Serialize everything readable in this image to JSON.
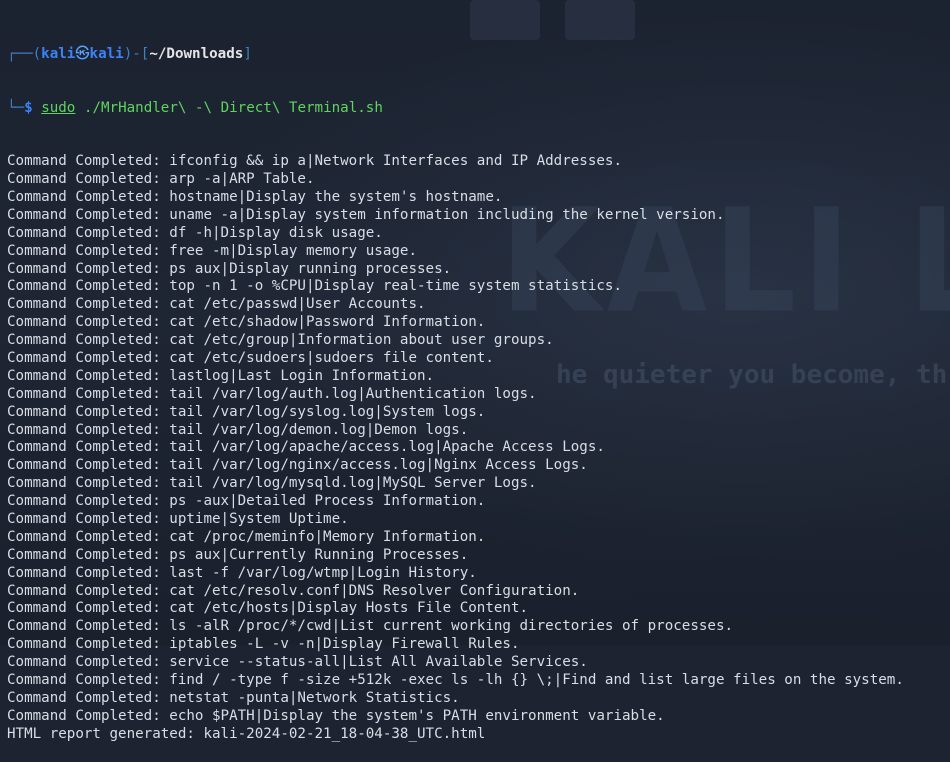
{
  "prompt": {
    "frame_top": "┌──(",
    "user": "kali",
    "at_symbol": "㉿",
    "host": "kali",
    "frame_mid": ")-[",
    "cwd": "~/Downloads",
    "frame_end": "]",
    "frame_bottom": "└─",
    "dollar": "$ ",
    "sudo": "sudo",
    "command": " ./MrHandler\\ -\\ Direct\\ Terminal.sh"
  },
  "output_lines": [
    "Command Completed: ifconfig && ip a|Network Interfaces and IP Addresses.",
    "Command Completed: arp -a|ARP Table.",
    "Command Completed: hostname|Display the system's hostname.",
    "Command Completed: uname -a|Display system information including the kernel version.",
    "Command Completed: df -h|Display disk usage.",
    "Command Completed: free -m|Display memory usage.",
    "Command Completed: ps aux|Display running processes.",
    "Command Completed: top -n 1 -o %CPU|Display real-time system statistics.",
    "Command Completed: cat /etc/passwd|User Accounts.",
    "Command Completed: cat /etc/shadow|Password Information.",
    "Command Completed: cat /etc/group|Information about user groups.",
    "Command Completed: cat /etc/sudoers|sudoers file content.",
    "Command Completed: lastlog|Last Login Information.",
    "Command Completed: tail /var/log/auth.log|Authentication logs.",
    "Command Completed: tail /var/log/syslog.log|System logs.",
    "Command Completed: tail /var/log/demon.log|Demon logs.",
    "Command Completed: tail /var/log/apache/access.log|Apache Access Logs.",
    "Command Completed: tail /var/log/nginx/access.log|Nginx Access Logs.",
    "Command Completed: tail /var/log/mysqld.log|MySQL Server Logs.",
    "Command Completed: ps -aux|Detailed Process Information.",
    "Command Completed: uptime|System Uptime.",
    "Command Completed: cat /proc/meminfo|Memory Information.",
    "Command Completed: ps aux|Currently Running Processes.",
    "Command Completed: last -f /var/log/wtmp|Login History.",
    "Command Completed: cat /etc/resolv.conf|DNS Resolver Configuration.",
    "Command Completed: cat /etc/hosts|Display Hosts File Content.",
    "Command Completed: ls -alR /proc/*/cwd|List current working directories of processes.",
    "Command Completed: iptables -L -v -n|Display Firewall Rules.",
    "Command Completed: service --status-all|List All Available Services.",
    "Command Completed: find / -type f -size +512k -exec ls -lh {} \\;|Find and list large files on the system.",
    "Command Completed: netstat -punta|Network Statistics.",
    "Command Completed: echo $PATH|Display the system's PATH environment variable.",
    "HTML report generated: kali-2024-02-21_18-04-38_UTC.html"
  ],
  "wallpaper": {
    "logo_text": "KALI L",
    "slogan": "he quieter you become, th"
  },
  "colors": {
    "background": "#1d2330",
    "prompt_blue": "#3b82f6",
    "command_green": "#5fd45f",
    "output_text": "#d8dde6"
  }
}
